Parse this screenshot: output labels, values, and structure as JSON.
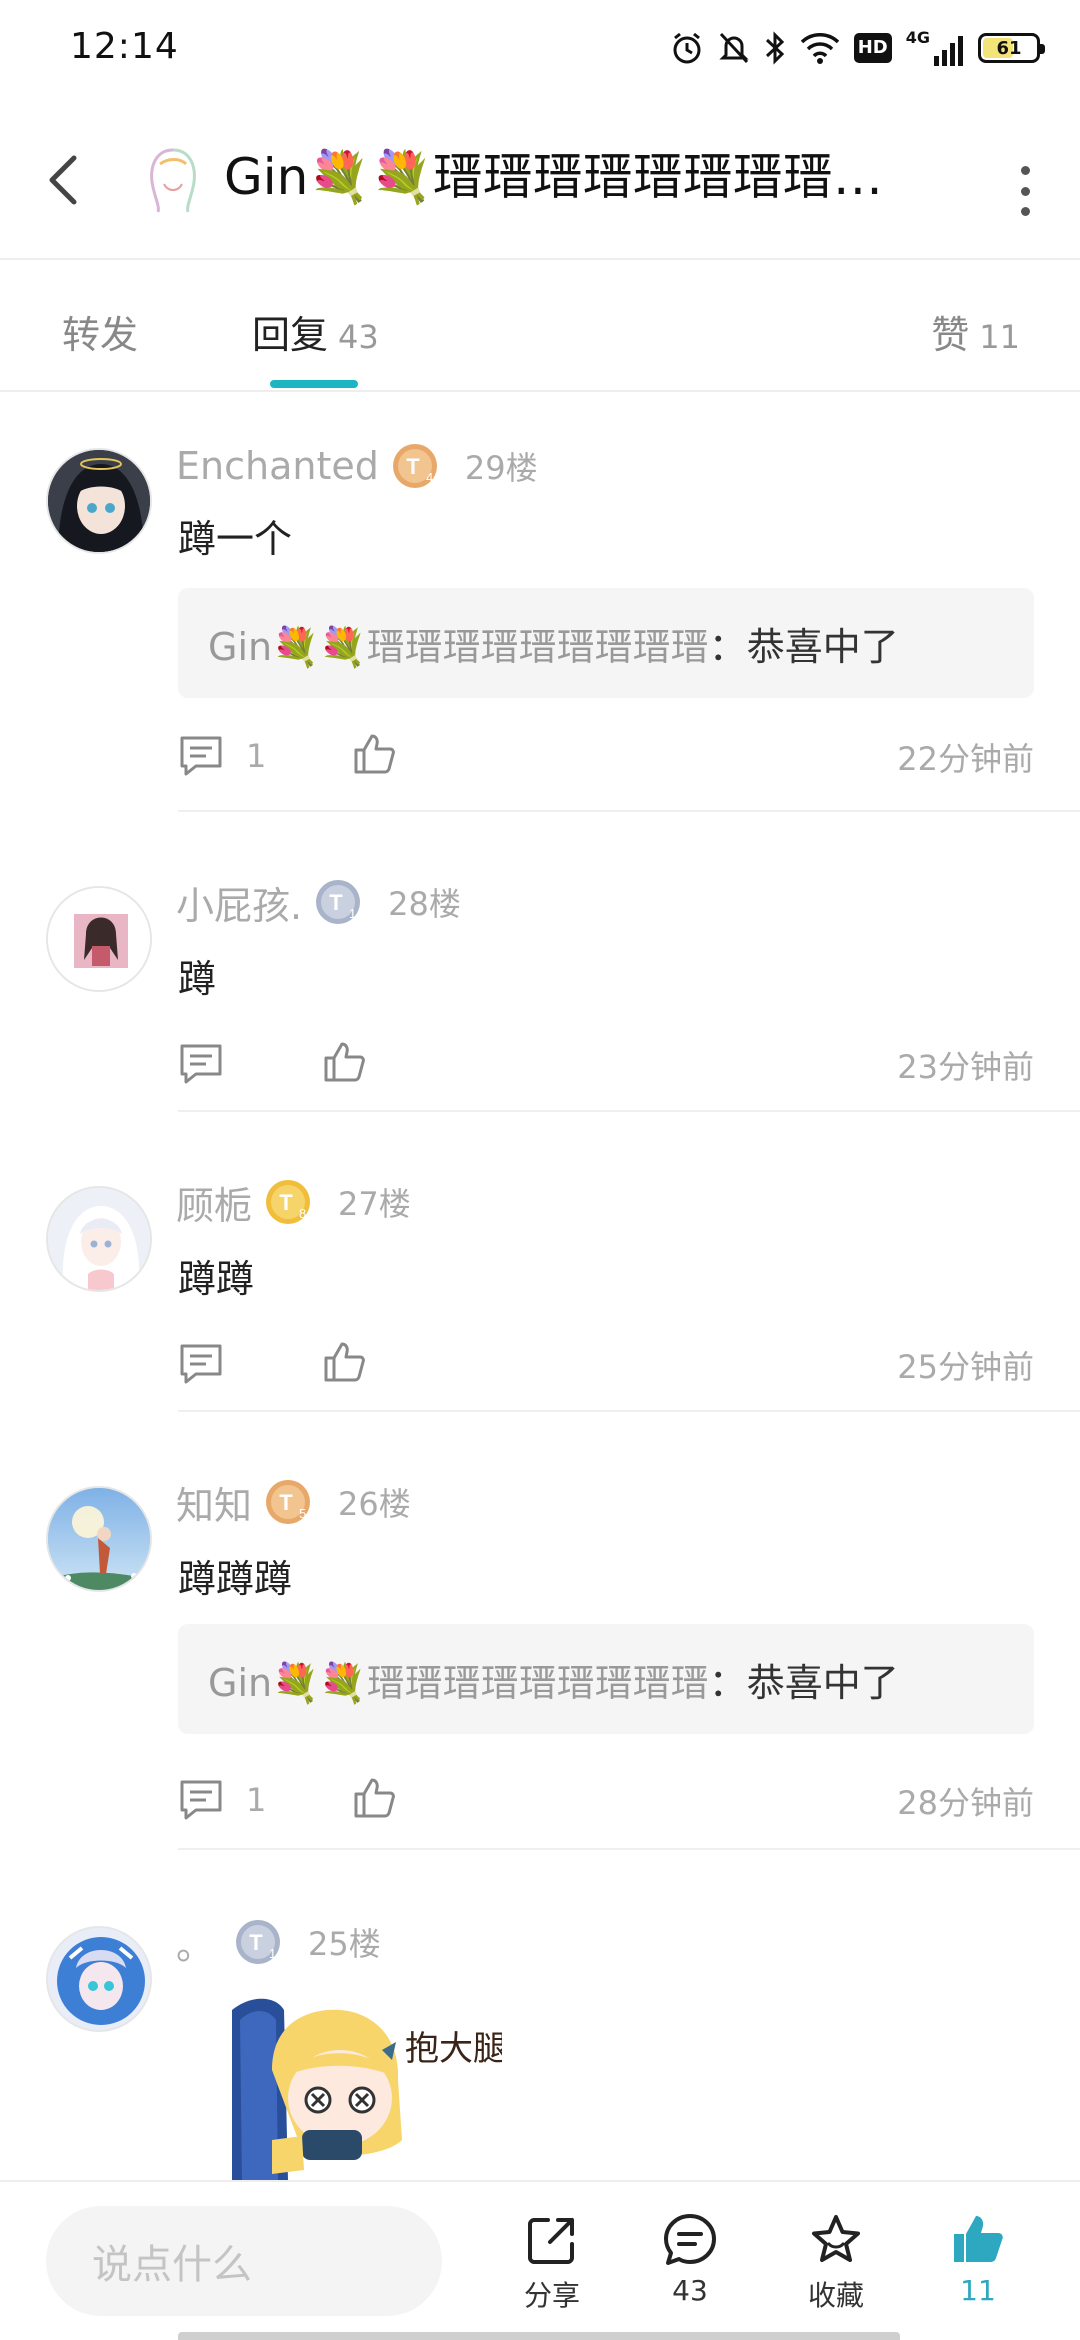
{
  "status_bar": {
    "time": "12:14",
    "hd": "HD",
    "network": "4G",
    "battery": "61",
    "battery_level": 0.61
  },
  "header": {
    "title": "Gin💐💐瑨瑨瑨瑨瑨瑨瑨瑨…",
    "icons": {
      "back": "chevron-left-icon",
      "more": "more-vertical-icon"
    }
  },
  "tabs": {
    "forward": {
      "label": "转发"
    },
    "reply": {
      "label": "回复",
      "count": "43"
    },
    "like": {
      "label": "赞",
      "count": "11"
    }
  },
  "comments": [
    {
      "name": "Enchanted",
      "badge": "T4",
      "badge_color": "#e8a869",
      "floor": "29楼",
      "text": "蹲一个",
      "quote": {
        "name": "Gin💐💐瑨瑨瑨瑨瑨瑨瑨瑨瑨",
        "text": "：恭喜中了"
      },
      "reply_count": "1",
      "time": "22分钟前"
    },
    {
      "name": "小屁孩.",
      "badge": "T1",
      "badge_color": "#a9b3c9",
      "floor": "28楼",
      "text": "蹲",
      "reply_count": "",
      "time": "23分钟前"
    },
    {
      "name": "顾栀",
      "badge": "T8",
      "badge_color": "#f0be3a",
      "floor": "27楼",
      "text": "蹲蹲",
      "reply_count": "",
      "time": "25分钟前"
    },
    {
      "name": "知知",
      "badge": "T5",
      "badge_color": "#e8a869",
      "floor": "26楼",
      "text": "蹲蹲蹲",
      "quote": {
        "name": "Gin💐💐瑨瑨瑨瑨瑨瑨瑨瑨瑨",
        "text": "：恭喜中了"
      },
      "reply_count": "1",
      "time": "28分钟前"
    },
    {
      "name": "。",
      "badge": "T1",
      "badge_color": "#a9b3c9",
      "floor": "25楼",
      "sticker_text": "抱大腿"
    }
  ],
  "bottom_bar": {
    "placeholder": "说点什么",
    "share_label": "分享",
    "comments_count": "43",
    "favorite_label": "收藏",
    "like_count": "11"
  }
}
